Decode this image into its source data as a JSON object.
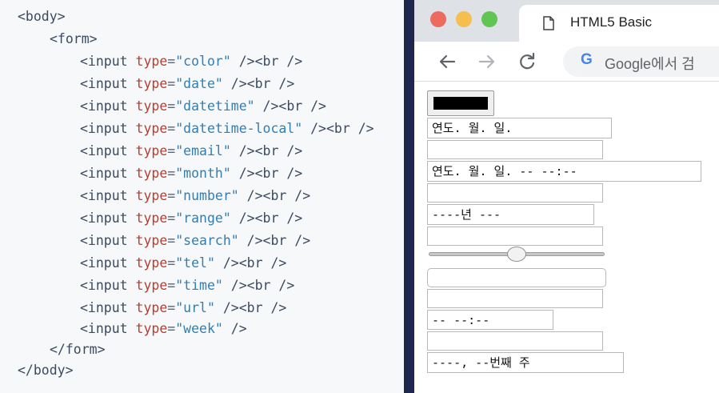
{
  "code": {
    "lines": [
      {
        "indent": 0,
        "open": "<body>"
      },
      {
        "indent": 1,
        "open": "<form>"
      },
      {
        "indent": 2,
        "tag": "<input",
        "attr": "type",
        "eq": "=",
        "value": "\"color\"",
        "end": " /><br />"
      },
      {
        "indent": 2,
        "tag": "<input",
        "attr": "type",
        "eq": "=",
        "value": "\"date\"",
        "end": " /><br />"
      },
      {
        "indent": 2,
        "tag": "<input",
        "attr": "type",
        "eq": "=",
        "value": "\"datetime\"",
        "end": " /><br />"
      },
      {
        "indent": 2,
        "tag": "<input",
        "attr": "type",
        "eq": "=",
        "value": "\"datetime-local\"",
        "end": " /><br />"
      },
      {
        "indent": 2,
        "tag": "<input",
        "attr": "type",
        "eq": "=",
        "value": "\"email\"",
        "end": " /><br />"
      },
      {
        "indent": 2,
        "tag": "<input",
        "attr": "type",
        "eq": "=",
        "value": "\"month\"",
        "end": " /><br />"
      },
      {
        "indent": 2,
        "tag": "<input",
        "attr": "type",
        "eq": "=",
        "value": "\"number\"",
        "end": " /><br />"
      },
      {
        "indent": 2,
        "tag": "<input",
        "attr": "type",
        "eq": "=",
        "value": "\"range\"",
        "end": " /><br />"
      },
      {
        "indent": 2,
        "tag": "<input",
        "attr": "type",
        "eq": "=",
        "value": "\"search\"",
        "end": " /><br />"
      },
      {
        "indent": 2,
        "tag": "<input",
        "attr": "type",
        "eq": "=",
        "value": "\"tel\"",
        "end": " /><br />"
      },
      {
        "indent": 2,
        "tag": "<input",
        "attr": "type",
        "eq": "=",
        "value": "\"time\"",
        "end": " /><br />"
      },
      {
        "indent": 2,
        "tag": "<input",
        "attr": "type",
        "eq": "=",
        "value": "\"url\"",
        "end": " /><br />"
      },
      {
        "indent": 2,
        "tag": "<input",
        "attr": "type",
        "eq": "=",
        "value": "\"week\"",
        "end": " />"
      },
      {
        "indent": 1,
        "open": "</form>"
      },
      {
        "indent": 0,
        "open": "</body>"
      }
    ]
  },
  "browser": {
    "window_controls": [
      "close-dot",
      "minimize-dot",
      "maximize-dot"
    ],
    "tab": {
      "title": "HTML5 Basic",
      "icon": "page-icon"
    },
    "toolbar": {
      "back_icon": "back-arrow-icon",
      "forward_icon": "forward-arrow-icon",
      "reload_icon": "reload-icon",
      "omnibox_logo": "G",
      "omnibox_text": "Google에서 검"
    },
    "form": {
      "color_value": "#000000",
      "date_value": "연도. 월. 일.",
      "datetime_value": "",
      "datetime_local_value": "연도. 월. 일. -- --:--",
      "email_value": "",
      "month_value": "----년 ---",
      "number_value": "",
      "range_value_fraction": 0.5,
      "search_value": "",
      "tel_value": "",
      "time_value": "-- --:--",
      "url_value": "",
      "week_value": "----, --번째 주"
    }
  },
  "colors": {
    "code_background": "#f6f8fa",
    "tag": "#3a4a60",
    "attribute": "#c0392b",
    "string": "#2f7fb5",
    "divider": "#20274e",
    "titlebar": "#dee1e6"
  }
}
